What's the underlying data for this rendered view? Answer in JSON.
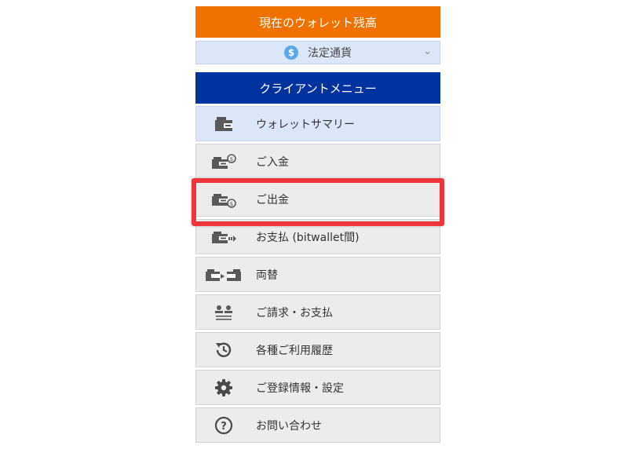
{
  "wallet_header": {
    "label": "現在のウォレット残高"
  },
  "currency": {
    "selected": "法定通貨",
    "symbol": "$"
  },
  "client_menu": {
    "title": "クライアントメニュー",
    "items": [
      {
        "label": "ウォレットサマリー",
        "icon": "wallet-icon",
        "active": true
      },
      {
        "label": "ご入金",
        "icon": "wallet-deposit-icon"
      },
      {
        "label": "ご出金",
        "icon": "wallet-withdraw-icon",
        "highlighted": true
      },
      {
        "label": "お支払 (bitwallet間)",
        "icon": "wallet-transfer-icon"
      },
      {
        "label": "両替",
        "icon": "exchange-icon"
      },
      {
        "label": "ご請求・お支払",
        "icon": "users-transfer-icon"
      },
      {
        "label": "各種ご利用履歴",
        "icon": "history-icon"
      },
      {
        "label": "ご登録情報・設定",
        "icon": "gear-icon"
      },
      {
        "label": "お問い合わせ",
        "icon": "question-icon"
      }
    ]
  },
  "colors": {
    "orange": "#f07000",
    "navy": "#0033a0",
    "highlight": "#f0353a"
  }
}
